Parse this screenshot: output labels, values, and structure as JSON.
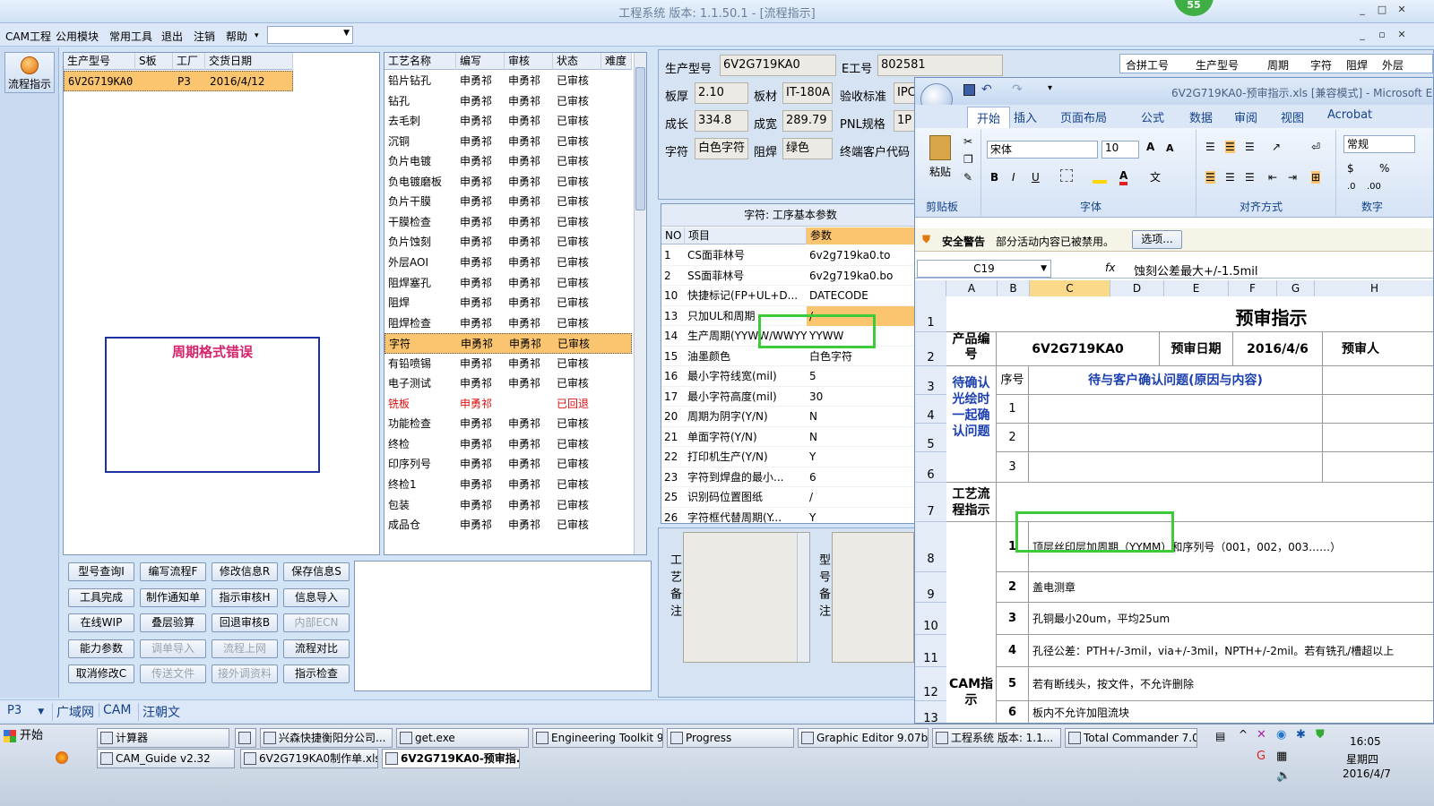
{
  "window": {
    "title": "工程系统  版本: 1.1.50.1 - [流程指示]",
    "badge": "55"
  },
  "menu": {
    "items": [
      "CAM工程",
      "公用模块",
      "常用工具",
      "退出",
      "注销",
      "帮助"
    ],
    "help_arrow": "▾",
    "combo_value": ""
  },
  "sidebar": {
    "flow_label": "流程指示"
  },
  "model_list": {
    "headers": [
      "生产型号",
      "S板",
      "工厂",
      "交货日期"
    ],
    "rows": [
      [
        "6V2G719KA0",
        "",
        "P3",
        "2016/4/12"
      ]
    ]
  },
  "error_box": {
    "text": "周期格式错误"
  },
  "process": {
    "headers": [
      "工艺名称",
      "编写",
      "审核",
      "状态",
      "难度"
    ],
    "rows": [
      [
        "铅片钻孔",
        "申勇祁",
        "申勇祁",
        "已审核"
      ],
      [
        "钻孔",
        "申勇祁",
        "申勇祁",
        "已审核"
      ],
      [
        "去毛刺",
        "申勇祁",
        "申勇祁",
        "已审核"
      ],
      [
        "沉铜",
        "申勇祁",
        "申勇祁",
        "已审核"
      ],
      [
        "负片电镀",
        "申勇祁",
        "申勇祁",
        "已审核"
      ],
      [
        "负电镀磨板",
        "申勇祁",
        "申勇祁",
        "已审核"
      ],
      [
        "负片干膜",
        "申勇祁",
        "申勇祁",
        "已审核"
      ],
      [
        "干膜检查",
        "申勇祁",
        "申勇祁",
        "已审核"
      ],
      [
        "负片蚀刻",
        "申勇祁",
        "申勇祁",
        "已审核"
      ],
      [
        "外层AOI",
        "申勇祁",
        "申勇祁",
        "已审核"
      ],
      [
        "阻焊塞孔",
        "申勇祁",
        "申勇祁",
        "已审核"
      ],
      [
        "阻焊",
        "申勇祁",
        "申勇祁",
        "已审核"
      ],
      [
        "阻焊检查",
        "申勇祁",
        "申勇祁",
        "已审核"
      ],
      [
        "字符",
        "申勇祁",
        "申勇祁",
        "已审核"
      ],
      [
        "有铅喷锡",
        "申勇祁",
        "申勇祁",
        "已审核"
      ],
      [
        "电子测试",
        "申勇祁",
        "申勇祁",
        "已审核"
      ],
      [
        "铣板",
        "申勇祁",
        "",
        "已回退"
      ],
      [
        "功能检查",
        "申勇祁",
        "申勇祁",
        "已审核"
      ],
      [
        "终检",
        "申勇祁",
        "申勇祁",
        "已审核"
      ],
      [
        "印序列号",
        "申勇祁",
        "申勇祁",
        "已审核"
      ],
      [
        "终检1",
        "申勇祁",
        "申勇祁",
        "已审核"
      ],
      [
        "包装",
        "申勇祁",
        "申勇祁",
        "已审核"
      ],
      [
        "成品仓",
        "申勇祁",
        "申勇祁",
        "已审核"
      ]
    ]
  },
  "buttons": [
    {
      "label": "型号查询I",
      "enabled": true
    },
    {
      "label": "编写流程F",
      "enabled": true
    },
    {
      "label": "修改信息R",
      "enabled": true
    },
    {
      "label": "保存信息S",
      "enabled": true
    },
    {
      "label": "工具完成",
      "enabled": true
    },
    {
      "label": "制作通知单",
      "enabled": true
    },
    {
      "label": "指示审核H",
      "enabled": true
    },
    {
      "label": "信息导入",
      "enabled": true
    },
    {
      "label": "在线WIP",
      "enabled": true
    },
    {
      "label": "叠层验算",
      "enabled": true
    },
    {
      "label": "回退审核B",
      "enabled": true
    },
    {
      "label": "内部ECN",
      "enabled": false
    },
    {
      "label": "能力参数",
      "enabled": true
    },
    {
      "label": "调单导入",
      "enabled": false
    },
    {
      "label": "流程上网",
      "enabled": false
    },
    {
      "label": "流程对比",
      "enabled": true
    },
    {
      "label": "取消修改C",
      "enabled": true
    },
    {
      "label": "传送文件",
      "enabled": false
    },
    {
      "label": "接外调资料",
      "enabled": false
    },
    {
      "label": "指示检查",
      "enabled": true
    }
  ],
  "info": {
    "model_label": "生产型号",
    "model": "6V2G719KA0",
    "e_label": "E工号",
    "e_no": "802581",
    "thick_label": "板厚",
    "thick": "2.10",
    "mat_label": "板材",
    "mat": "IT-180A",
    "std_label": "验收标准",
    "std": "IPC",
    "len_label": "成长",
    "len": "334.8",
    "wid_label": "成宽",
    "wid": "289.79",
    "pnl_label": "PNL规格",
    "pnl": "1P",
    "char_label": "字符",
    "char": "白色字符",
    "mask_label": "阻焊",
    "mask": "绿色",
    "cust_label": "终端客户代码"
  },
  "combine_headers": [
    "合拼工号",
    "生产型号",
    "周期",
    "字符",
    "阻焊",
    "外层"
  ],
  "params": {
    "title": "字符: 工序基本参数",
    "headers": [
      "NO",
      "项目",
      "参数"
    ],
    "rows": [
      [
        "1",
        "CS面菲林号",
        "6v2g719ka0.to"
      ],
      [
        "2",
        "SS面菲林号",
        "6v2g719ka0.bo"
      ],
      [
        "10",
        "快捷标记(FP+UL+D...",
        "DATECODE"
      ],
      [
        "13",
        "只加UL和周期",
        "/"
      ],
      [
        "14",
        "生产周期(YYWW/WWYY)",
        "YYWW"
      ],
      [
        "15",
        "油墨颜色",
        "白色字符"
      ],
      [
        "16",
        "最小字符线宽(mil)",
        "5"
      ],
      [
        "17",
        "最小字符高度(mil)",
        "30"
      ],
      [
        "20",
        "周期为阴字(Y/N)",
        "N"
      ],
      [
        "21",
        "单面字符(Y/N)",
        "N"
      ],
      [
        "22",
        "打印机生产(Y/N)",
        "Y"
      ],
      [
        "23",
        "字符到焊盘的最小...",
        "6"
      ],
      [
        "25",
        "识别码位置图纸",
        "/"
      ],
      [
        "26",
        "字符框代替周期(Y...",
        "Y"
      ]
    ]
  },
  "notes": {
    "process_label": "工艺备注",
    "model_label": "型号备注"
  },
  "statusbar": {
    "plant": "P3",
    "tabs": [
      "广域网",
      "CAM",
      "汪朝文"
    ]
  },
  "excel": {
    "title": "6V2G719KA0-预审指示.xls [兼容模式] - Microsoft Excel",
    "tabs": [
      "开始",
      "插入",
      "页面布局",
      "公式",
      "数据",
      "审阅",
      "视图",
      "Acrobat"
    ],
    "groups": [
      "剪贴板",
      "字体",
      "对齐方式",
      "数字"
    ],
    "paste_label": "粘贴",
    "font_name": "宋体",
    "font_size": "10",
    "number_format": "常规",
    "security_label": "安全警告",
    "security_text": "部分活动内容已被禁用。",
    "options_btn": "选项...",
    "name_box": "C19",
    "fx": "fx",
    "formula": "蚀刻公差最大+/-1.5mil",
    "cols": [
      "A",
      "B",
      "C",
      "D",
      "E",
      "F",
      "G",
      "H"
    ],
    "rownums": [
      "1",
      "2",
      "3",
      "4",
      "5",
      "6",
      "7",
      "8",
      "9",
      "10",
      "11",
      "12",
      "13"
    ],
    "sheet_title": "预审指示",
    "product_label": "产品编号",
    "product": "6V2G719KA0",
    "prereview_date_label": "预审日期",
    "prereview_date": "2016/4/6",
    "prereviewer_label": "预审人",
    "seq_label": "序号",
    "question_header": "待与客户确认问题(原因与内容)",
    "confirm_label": "待确认光绘时一起确认问题",
    "confirm_nums": [
      "1",
      "2",
      "3"
    ],
    "flow_label": "工艺流程指示",
    "cam_label": "CAM指示",
    "cam_items": [
      [
        "1",
        "顶层丝印层加周期（YYMM）和序列号（001，002，003……）"
      ],
      [
        "2",
        "盖电测章"
      ],
      [
        "3",
        "孔铜最小20um，平均25um"
      ],
      [
        "4",
        "孔径公差：PTH+/-3mil，via+/-3mil，NPTH+/-2mil。若有铣孔/槽超以上"
      ],
      [
        "5",
        "若有断线头，按文件，不允许删除"
      ],
      [
        "6",
        "板内不允许加阻流块"
      ]
    ]
  },
  "taskbar": {
    "start": "开始",
    "tasks_row1": [
      "计算器",
      "",
      "兴森快捷衡阳分公司...",
      "get.exe",
      "Engineering Toolkit 9.0...",
      "Progress",
      "Graphic Editor 9.07b2 (...",
      "工程系统  版本: 1.1...",
      "Total Commander 7.0 ..."
    ],
    "tasks_row2": [
      "CAM_Guide v2.32",
      "6V2G719KA0制作单.xls ...",
      "6V2G719KA0-预审指..."
    ],
    "time": "16:05",
    "weekday": "星期四",
    "date": "2016/4/7"
  }
}
